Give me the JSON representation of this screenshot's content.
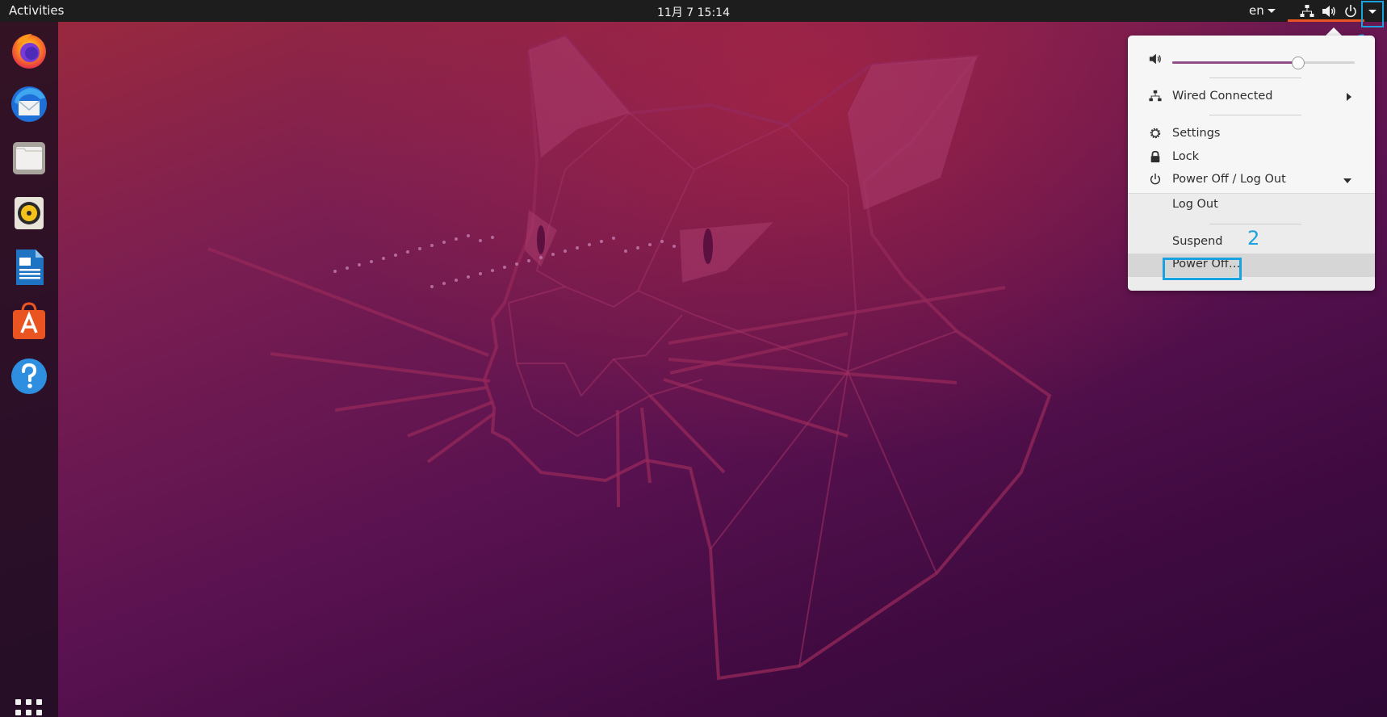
{
  "topbar": {
    "activities_label": "Activities",
    "clock": "11月 7  15:14",
    "language": "en",
    "tray_icons": [
      "network-icon",
      "volume-icon",
      "power-icon"
    ],
    "menu_arrow": "chevron-down-icon"
  },
  "dock": {
    "items": [
      {
        "name": "firefox",
        "icon": "firefox-icon"
      },
      {
        "name": "thunderbird",
        "icon": "thunderbird-icon"
      },
      {
        "name": "files",
        "icon": "files-icon"
      },
      {
        "name": "rhythmbox",
        "icon": "rhythmbox-icon"
      },
      {
        "name": "libreoffice-writer",
        "icon": "writer-icon"
      },
      {
        "name": "ubuntu-software",
        "icon": "software-icon"
      },
      {
        "name": "help",
        "icon": "help-icon"
      }
    ],
    "show_apps_icon": "apps-grid-icon"
  },
  "system_menu": {
    "volume": {
      "icon": "volume-icon",
      "level": 0.69
    },
    "wired_label": "Wired Connected",
    "settings_label": "Settings",
    "lock_label": "Lock",
    "power_label": "Power Off / Log Out",
    "submenu": {
      "logout_label": "Log Out",
      "suspend_label": "Suspend",
      "poweroff_label": "Power Off…"
    }
  },
  "annotations": {
    "step1": "1",
    "step2": "2"
  },
  "colors": {
    "accent": "#e95420",
    "highlight_box": "#1aa1e0",
    "slider_fill": "#924d8b",
    "topbar": "#1d1d1d"
  }
}
